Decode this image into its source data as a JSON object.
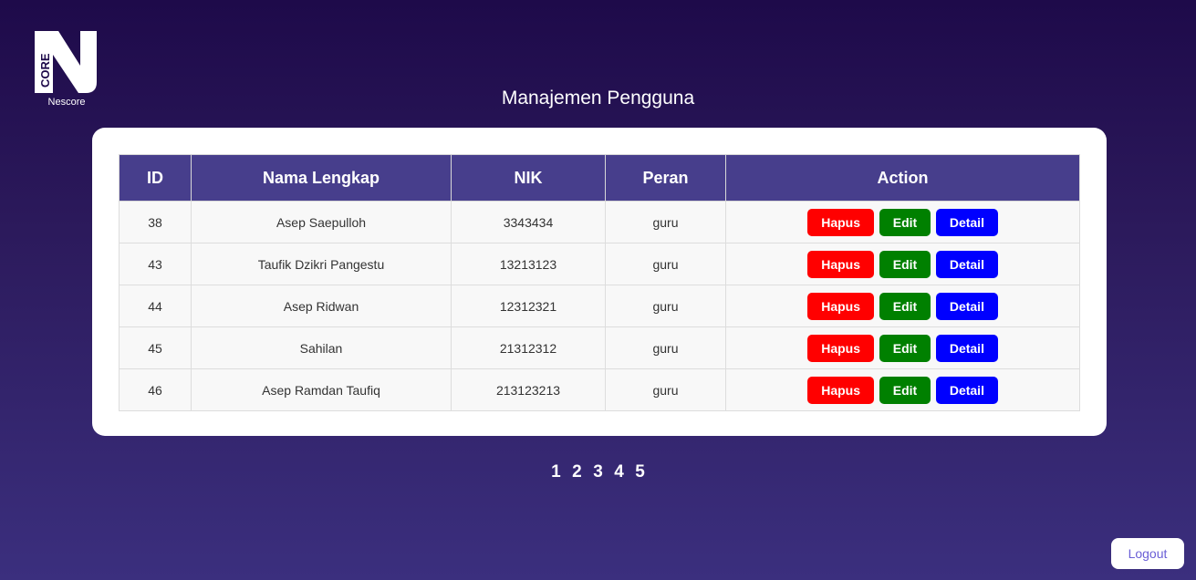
{
  "brand": {
    "logo_mark_letter": "N",
    "logo_mark_text": "CORE",
    "name": "Nescore"
  },
  "page": {
    "title": "Manajemen Pengguna"
  },
  "table": {
    "headers": [
      "ID",
      "Nama Lengkap",
      "NIK",
      "Peran",
      "Action"
    ],
    "rows": [
      {
        "id": "38",
        "name": "Asep Saepulloh",
        "nik": "3343434",
        "role": "guru"
      },
      {
        "id": "43",
        "name": "Taufik Dzikri Pangestu",
        "nik": "13213123",
        "role": "guru"
      },
      {
        "id": "44",
        "name": "Asep Ridwan",
        "nik": "12312321",
        "role": "guru"
      },
      {
        "id": "45",
        "name": "Sahilan",
        "nik": "21312312",
        "role": "guru"
      },
      {
        "id": "46",
        "name": "Asep Ramdan Taufiq",
        "nik": "213123213",
        "role": "guru"
      }
    ],
    "actions": {
      "delete_label": "Hapus",
      "edit_label": "Edit",
      "detail_label": "Detail"
    }
  },
  "pagination": {
    "pages": [
      "1",
      "2",
      "3",
      "4",
      "5"
    ]
  },
  "logout_label": "Logout",
  "colors": {
    "header_bg": "#473e8c",
    "delete": "#ff0000",
    "edit": "#008000",
    "detail": "#0000ff"
  }
}
